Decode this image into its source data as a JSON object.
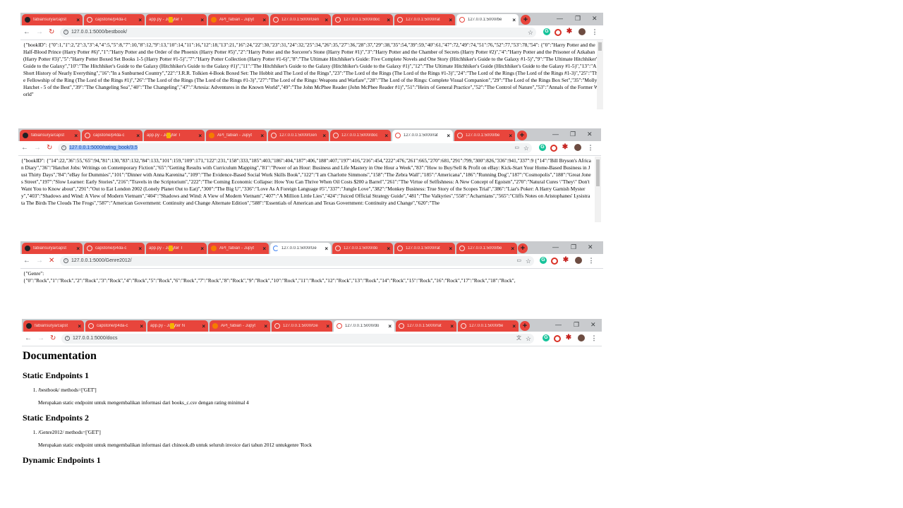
{
  "windows": [
    {
      "tabs": [
        {
          "title": "fabiansurya/capst",
          "icon": "github-icon"
        },
        {
          "title": "capstone/p4da-c",
          "icon": "ring-icon"
        },
        {
          "title": "app.py - Jupyter T",
          "icon": "document-icon"
        },
        {
          "title": "API_fabian - Jupyt",
          "icon": "jupyter-icon"
        },
        {
          "title": "127.0.0.1:5000/Gen",
          "icon": "ring-icon"
        },
        {
          "title": "127.0.0.1:5000/doc",
          "icon": "ring-icon"
        },
        {
          "title": "127.0.0.1:5000/rat",
          "icon": "ring-icon"
        },
        {
          "title": "127.0.0.1:5000/be",
          "icon": "ring-icon",
          "active": true
        }
      ],
      "url": "127.0.0.1:5000/bestbook/",
      "body": "{\"bookID\": {\"0\":1,\"1\":2,\"2\":3,\"3\":4,\"4\":5,\"5\":8,\"7\":10,\"8\":12,\"9\":13,\"10\":14,\"11\":16,\"12\":18,\"13\":21,\"16\":24,\"22\":30,\"23\":31,\"24\":32,\"25\":34,\"26\":35,\"27\":36,\"28\":37,\"29\":38,\"35\":54,\"39\":59,\"40\":61,\"47\":72,\"49\":74,\"51\":76,\"52\":77,\"53\":78,\"54\": {\"0\":\"Harry Potter and the Half-Blood Prince (Harry Potter #6)\",\"1\":\"Harry Potter and the Order of the Phoenix (Harry Potter #5)\",\"2\":\"Harry Potter and the Sorcerer's Stone (Harry Potter #1)\",\"3\":\"Harry Potter and the Chamber of Secrets (Harry Potter #2)\",\"4\":\"Harry Potter and the Prisoner of Azkaban (Harry Potter #3)\",\"5\":\"Harry Potter Boxed Set Books 1-5 (Harry Potter #1-5)\",\"7\":\"Harry Potter Collection (Harry Potter #1-6)\",\"8\":\"The Ultimate Hitchhiker's Guide: Five Complete Novels and One Story (Hitchhiker's Guide to the Galaxy #1-5)\",\"9\":\"The Ultimate Hitchhiker's Guide to the Galaxy\",\"10\":\"The Hitchhiker's Guide to the Galaxy (Hitchhiker's Guide to the Galaxy #1)\",\"11\":\"The Hitchhiker's Guide to the Galaxy (Hitchhiker's Guide to the Galaxy #1)\",\"12\":\"The Ultimate Hitchhiker's Guide (Hitchhiker's Guide to the Galaxy #1-5)\",\"13\":\"A Short History of Nearly Everything\",\"16\":\"In a Sunburned Country\",\"22\":\"J.R.R. Tolkien 4-Book Boxed Set: The Hobbit and The Lord of the Rings\",\"23\":\"The Lord of the Rings (The Lord of the Rings #1-3)\",\"24\":\"The Lord of the Rings (The Lord of the Rings #1-3)\",\"25\":\"The Fellowship of the Ring (The Lord of the Rings #1)\",\"26\":\"The Lord of the Rings (The Lord of the Rings #1-3)\",\"27\":\"The Lord of the Rings: Weapons and Warfare\",\"28\":\"The Lord of the Rings: Complete Visual Companion\",\"29\":\"The Lord of the Rings Box Set\",\"35\":\"Molly Hatchet - 5 of the Best\",\"39\":\"The Changeling Sea\",\"40\":\"The Changeling\",\"47\":\"Artesia: Adventures in the Known World\",\"49\":\"The John McPhee Reader (John McPhee Reader #1)\",\"51\":\"Heirs of General Practice\",\"52\":\"The Control of Nature\",\"53\":\"Annals of the Former World\""
    },
    {
      "tabs": [
        {
          "title": "fabiansurya/capst",
          "icon": "github-icon"
        },
        {
          "title": "capstone/p4da-c",
          "icon": "ring-icon"
        },
        {
          "title": "app.py - Jupyter T",
          "icon": "document-icon"
        },
        {
          "title": "API_fabian - Jupyt",
          "icon": "jupyter-icon"
        },
        {
          "title": "127.0.0.1:5000/Gen",
          "icon": "ring-icon"
        },
        {
          "title": "127.0.0.1:5000/doc",
          "icon": "ring-icon"
        },
        {
          "title": "127.0.0.1:5000/rat",
          "icon": "ring-icon",
          "active": true
        },
        {
          "title": "127.0.0.1:5000/be",
          "icon": "ring-icon"
        }
      ],
      "url": "127.0.0.1:5000/rating_book/3.5",
      "body": "{\"bookID\": {\"14\":22,\"36\":55,\"65\":94,\"81\":130,\"83\":132,\"84\":133,\"101\":159,\"109\":171,\"122\":231,\"158\":333,\"185\":403,\"186\":404,\"187\":406,\"188\":407,\"197\":416,\"216\":454,\"222\":476,\"261\":665,\"270\":681,\"291\":799,\"300\":826,\"336\":941,\"337\":9 {\"14\":\"Bill Bryson's African Diary\",\"36\":\"Hatchet Jobs: Writings on Contemporary Fiction\",\"65\":\"Getting Results with Curriculum Mapping\",\"81\":\"Power of an Hour: Business and Life Mastery in One Hour a Week\",\"83\":\"How to Buy/Sell & Profit on eBay: Kick-Start Your Home-Based Business in Just Thirty Days\",\"84\":\"eBay for Dummies\",\"101\":\"Dinner with Anna Karenina\",\"109\":\"The Evidence-Based Social Work Skills Book\",\"122\":\"I am Charlotte Simmons\",\"158\":\"The Zebra Wall\",\"185\":\"Americana\",\"186\":\"Running Dog\",\"187\":\"Cosmopolis\",\"188\":\"Great Jones Street\",\"197\":\"Slow Learner: Early Stories\",\"216\":\"Travels in the Scriptorium\",\"222\":\"The Coming Economic Collapse: How You Can Thrive When Oil Costs $200 a Barrel\",\"261\":\"The Virtue of Selfishness: A New Concept of Egoism\",\"270\":\"Natural Cures \\\"They\\\" Don't Want You to Know about\",\"291\":\"Out to Eat London 2002 (Lonely Planet Out to Eat)\",\"300\":\"The Big U\",\"336\":\"Love As A Foreign Language #5\",\"337\":\"Jungle Love\",\"382\":\"Monkey Business: True Story of the Scopes Trial\",\"386\":\"Liar's Poker: A Harry Garnish Mystery\",\"403\":\"Shadows and Wind: A View of Modern Vietnam\",\"404\":\"Shadows and Wind: A View of Modern Vietnam\",\"407\":\"A Million Little Lies\",\"424\":\"Juiced Official Strategy Guide\",\"481\":\"The Valkyries\",\"558\":\"Acharnians\",\"565\":\"Cliffs Notes on Aristophanes' Lysistrata The Birds The Clouds The Frogs\",\"587\":\"American Government: Continuity and Change Alternate Edition\",\"588\":\"Essentials of American and Texas Government: Continuity and Change\",\"620\":\"The"
    },
    {
      "tabs": [
        {
          "title": "fabiansurya/capst",
          "icon": "github-icon"
        },
        {
          "title": "capstone/p4da-c",
          "icon": "ring-icon"
        },
        {
          "title": "app.py - Jupyter T",
          "icon": "document-icon"
        },
        {
          "title": "API_fabian - Jupyt",
          "icon": "jupyter-icon"
        },
        {
          "title": "127.0.0.1:5000/Ge",
          "icon": "loading-icon",
          "active": true
        },
        {
          "title": "127.0.0.1:5000/do",
          "icon": "ring-icon"
        },
        {
          "title": "127.0.0.1:5000/rat",
          "icon": "ring-icon"
        },
        {
          "title": "127.0.0.1:5000/be",
          "icon": "ring-icon"
        }
      ],
      "url": "127.0.0.1:5000/Genre2012/",
      "body_line1": "{\"Genre\":",
      "body_line2": "{\"0\":\"Rock\",\"1\":\"Rock\",\"2\":\"Rock\",\"3\":\"Rock\",\"4\":\"Rock\",\"5\":\"Rock\",\"6\":\"Rock\",\"7\":\"Rock\",\"8\":\"Rock\",\"9\":\"Rock\",\"10\":\"Rock\",\"11\":\"Rock\",\"12\":\"Rock\",\"13\":\"Rock\",\"14\":\"Rock\",\"15\":\"Rock\",\"16\":\"Rock\",\"17\":\"Rock\",\"18\":\"Rock\","
    },
    {
      "tabs": [
        {
          "title": "fabiansurya/capst",
          "icon": "github-icon"
        },
        {
          "title": "capstone/p4da-c",
          "icon": "ring-icon"
        },
        {
          "title": "app.py - Jupyter N",
          "icon": "document-icon"
        },
        {
          "title": "API_fabian - Jupyt",
          "icon": "jupyter-icon"
        },
        {
          "title": "127.0.0.1:5000/Ge",
          "icon": "ring-icon"
        },
        {
          "title": "127.0.0.1:5000/do",
          "icon": "ring-icon",
          "active": true
        },
        {
          "title": "127.0.0.1:5000/rat",
          "icon": "ring-icon"
        },
        {
          "title": "127.0.0.1:5000/be",
          "icon": "ring-icon"
        }
      ],
      "url": "127.0.0.1:5000/docs"
    }
  ],
  "docs": {
    "title": "Documentation",
    "static1_heading": "Static Endpoints 1",
    "static1_item": "/bestbook/ methods=['GET']",
    "static1_desc": "Merupakan static endpoint untuk mengembalikan informasi dari books_c.csv dengan rating minimal 4",
    "static2_heading": "Static Endpoints 2",
    "static2_item": "/Genre2012/ methods=['GET']",
    "static2_desc": "Merupakan static endpoint untuk mengembalikan informasi dari chinook.db untuk seluruh invoice dari tahun 2012 untukgenre 'Rock",
    "dynamic1_heading": "Dynamic Endpoints 1"
  },
  "colors": {
    "tab_inactive": "#e8453c",
    "tab_active": "#ffffff",
    "tabbar": "#c9cbce",
    "selection": "#a8c7fa"
  }
}
